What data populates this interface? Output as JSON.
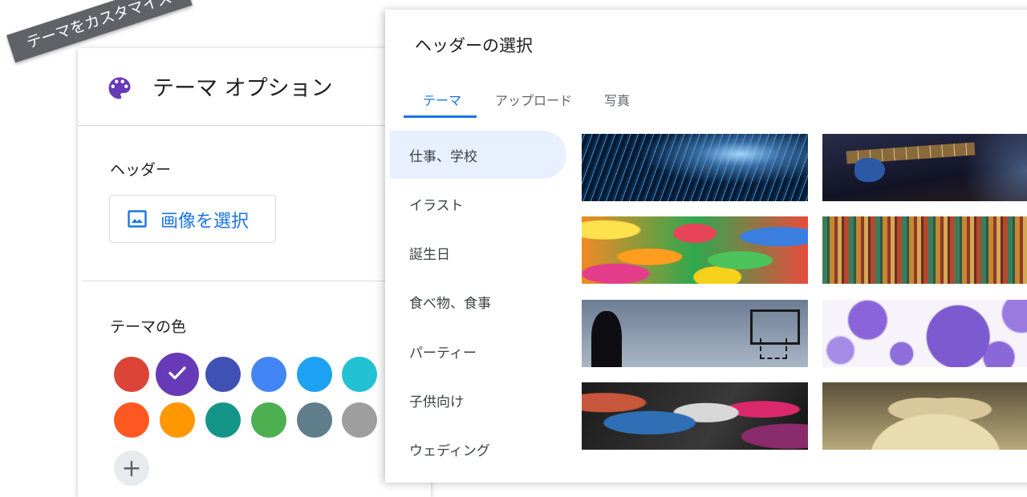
{
  "ribbon": {
    "text": "テーマをカスタマイズ"
  },
  "options_panel": {
    "title": "テーマ オプション",
    "icon": "palette-icon",
    "header_section_label": "ヘッダー",
    "select_image_button": "画像を選択",
    "theme_color_label": "テーマの色",
    "add_color_label": "+",
    "colors": [
      "#db4437",
      "#673ab7",
      "#3f51b5",
      "#4285f4",
      "#1da1f2",
      "#24c1d4",
      "#ff5722",
      "#ff9800",
      "#139688",
      "#4caf50",
      "#607d8b",
      "#9e9e9e"
    ],
    "selected_color": "#673ab7"
  },
  "dialog": {
    "title": "ヘッダーの選択",
    "tabs": [
      {
        "label": "テーマ",
        "active": true
      },
      {
        "label": "アップロード",
        "active": false
      },
      {
        "label": "写真",
        "active": false
      }
    ],
    "categories": [
      {
        "label": "仕事、学校",
        "active": true
      },
      {
        "label": "イラスト",
        "active": false
      },
      {
        "label": "誕生日",
        "active": false
      },
      {
        "label": "食べ物、食事",
        "active": false
      },
      {
        "label": "パーティー",
        "active": false
      },
      {
        "label": "子供向け",
        "active": false
      },
      {
        "label": "ウェディング",
        "active": false
      }
    ],
    "thumbnails": [
      "sparks",
      "guitar",
      "candy",
      "threads",
      "basketball-court",
      "bubbles",
      "painted-hand",
      "book-heart"
    ]
  }
}
